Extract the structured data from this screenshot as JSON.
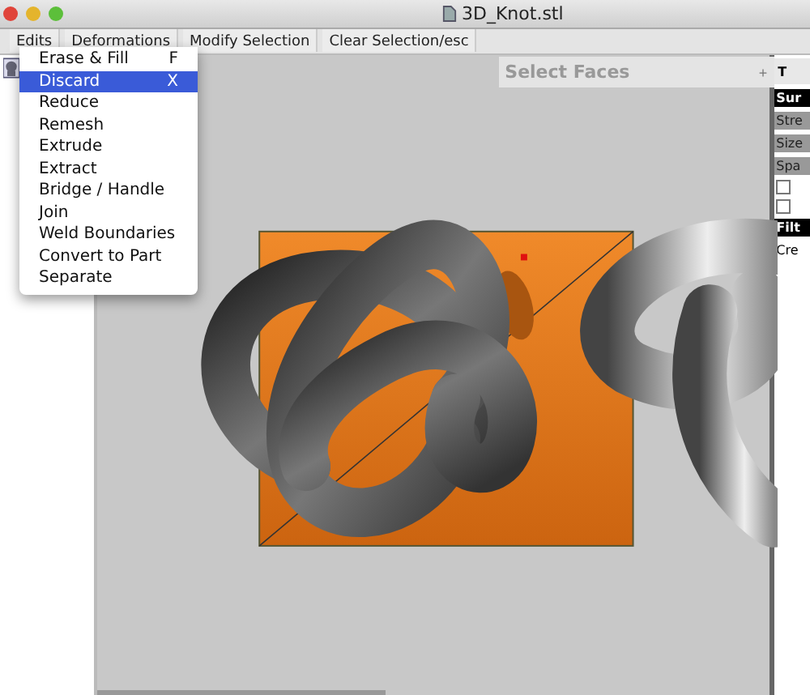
{
  "window": {
    "title": "3D_Knot.stl"
  },
  "toolbar": {
    "tabs": [
      {
        "label": "Edits"
      },
      {
        "label": "Deformations"
      },
      {
        "label": "Modify Selection"
      },
      {
        "label": "Clear Selection/esc"
      }
    ]
  },
  "menu": {
    "items": [
      {
        "label": "Erase & Fill",
        "shortcut": "F",
        "selected": false
      },
      {
        "label": "Discard",
        "shortcut": "X",
        "selected": true
      },
      {
        "label": "Reduce",
        "selected": false
      },
      {
        "label": "Remesh",
        "selected": false
      },
      {
        "label": "Extrude",
        "selected": false
      },
      {
        "label": "Extract",
        "selected": false
      },
      {
        "label": "Bridge / Handle",
        "selected": false
      },
      {
        "label": "Join",
        "selected": false
      },
      {
        "label": "Weld Boundaries",
        "selected": false
      },
      {
        "label": "Convert to Part",
        "selected": false
      },
      {
        "label": "Separate",
        "selected": false
      }
    ]
  },
  "viewport": {
    "panel_title": "Select Faces",
    "panel_button": "+"
  },
  "right_panel": {
    "tab": "T",
    "items": [
      {
        "kind": "header",
        "label": "Sur"
      },
      {
        "kind": "bar",
        "label": "Stre"
      },
      {
        "kind": "bar",
        "label": "Size"
      },
      {
        "kind": "bar",
        "label": "Spa"
      },
      {
        "kind": "checkbox",
        "checked": false
      },
      {
        "kind": "checkbox",
        "checked": false
      },
      {
        "kind": "header",
        "label": "Filt"
      },
      {
        "kind": "text",
        "label": "Cre"
      }
    ]
  }
}
